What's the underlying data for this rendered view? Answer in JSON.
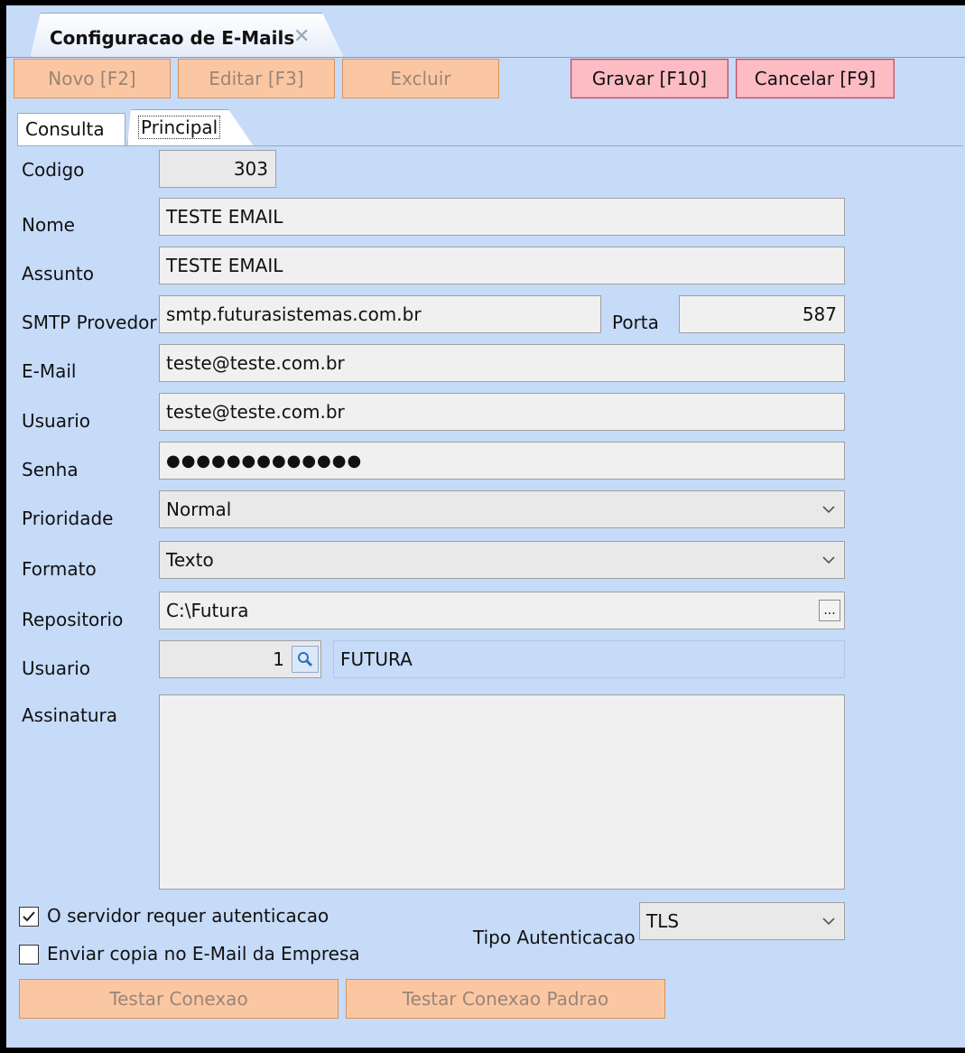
{
  "window": {
    "tab_title": "Configuracao de E-Mails",
    "close_glyph": "✕"
  },
  "toolbar": {
    "novo": "Novo [F2]",
    "editar": "Editar [F3]",
    "excluir": "Excluir",
    "gravar": "Gravar [F10]",
    "cancelar": "Cancelar [F9]"
  },
  "tabs": {
    "consulta": "Consulta",
    "principal": "Principal"
  },
  "form": {
    "codigo": {
      "label": "Codigo",
      "value": "303"
    },
    "nome": {
      "label": "Nome",
      "value": "TESTE EMAIL"
    },
    "assunto": {
      "label": "Assunto",
      "value": "TESTE EMAIL"
    },
    "smtp": {
      "label": "SMTP Provedor",
      "value": "smtp.futurasistemas.com.br"
    },
    "porta": {
      "label": "Porta",
      "value": "587"
    },
    "email": {
      "label": "E-Mail",
      "value": "teste@teste.com.br"
    },
    "usuario": {
      "label": "Usuario",
      "value": "teste@teste.com.br"
    },
    "senha": {
      "label": "Senha",
      "value": "●●●●●●●●●●●●●"
    },
    "prioridade": {
      "label": "Prioridade",
      "value": "Normal"
    },
    "formato": {
      "label": "Formato",
      "value": "Texto"
    },
    "repositorio": {
      "label": "Repositorio",
      "value": "C:\\Futura",
      "button": "..."
    },
    "usuario_id": {
      "label": "Usuario",
      "value": "1",
      "name": "FUTURA"
    },
    "assinatura": {
      "label": "Assinatura",
      "value": ""
    }
  },
  "options": {
    "requer_autenticacao": {
      "label": "O servidor requer autenticacao",
      "checked": true
    },
    "enviar_copia": {
      "label": "Enviar copia no E-Mail da Empresa",
      "checked": false
    },
    "tipo_autenticacao": {
      "label": "Tipo Autenticacao",
      "value": "TLS"
    }
  },
  "actions": {
    "testar_conexao": "Testar Conexao",
    "testar_conexao_padrao": "Testar Conexao Padrao"
  },
  "icons": {
    "dropdown": "chevron-down-icon",
    "lookup": "magnifier-icon",
    "check": "checkmark-icon"
  },
  "colors": {
    "background": "#c6dbf8",
    "disabled_button": "#fbc7a3",
    "active_button": "#fdbcc4"
  }
}
